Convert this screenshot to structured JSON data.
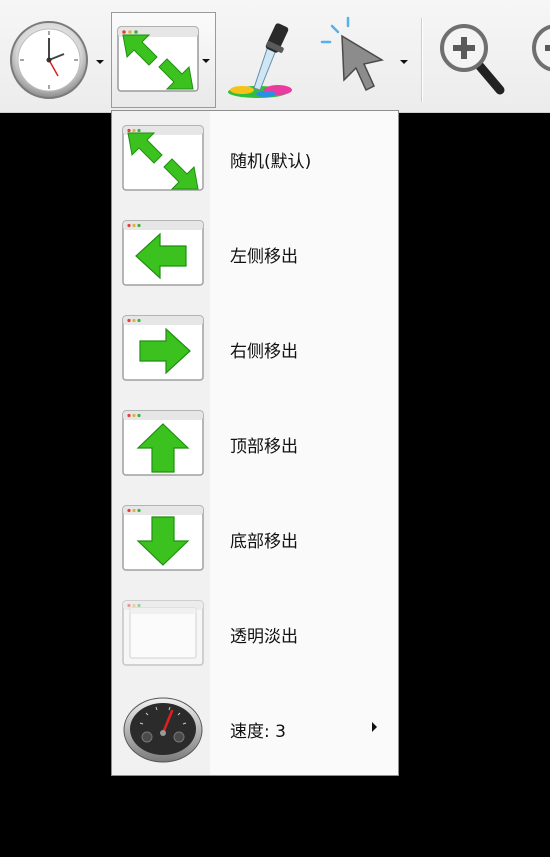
{
  "menu": {
    "items": [
      {
        "label": "随机(默认)",
        "icon": "random-arrows-icon"
      },
      {
        "label": "左侧移出",
        "icon": "arrow-left-window-icon"
      },
      {
        "label": "右侧移出",
        "icon": "arrow-right-window-icon"
      },
      {
        "label": "顶部移出",
        "icon": "arrow-up-window-icon"
      },
      {
        "label": "底部移出",
        "icon": "arrow-down-window-icon"
      },
      {
        "label": "透明淡出",
        "icon": "fade-window-icon"
      },
      {
        "label": "速度: 3",
        "icon": "speedometer-icon",
        "has_submenu": true
      }
    ]
  },
  "colors": {
    "arrow_green": "#3cc21e",
    "arrow_green_dark": "#1f8f12",
    "menu_bg": "#fafafa",
    "toolbar_bg": "#efefef"
  },
  "toolbar": {
    "icons": [
      "clock-icon",
      "transition-effect-icon",
      "color-picker-icon",
      "pointer-icon",
      "zoom-in-icon",
      "zoom-out-icon"
    ]
  }
}
